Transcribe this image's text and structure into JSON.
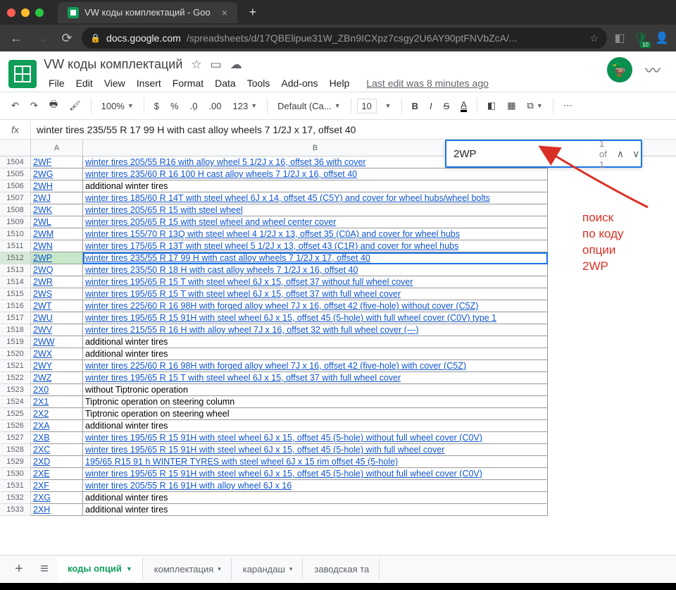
{
  "browser": {
    "tab_title": "VW коды комплектаций - Goo",
    "url_domain": "docs.google.com",
    "url_path": "/spreadsheets/d/17QBElipue31W_ZBn9ICXpz7csgy2U6AY90ptFNVbZcA/...",
    "ext_badge": "10"
  },
  "doc": {
    "title": "VW коды комплектаций",
    "last_edit": "Last edit was 8 minutes ago"
  },
  "menu": [
    "File",
    "Edit",
    "View",
    "Insert",
    "Format",
    "Data",
    "Tools",
    "Add-ons",
    "Help"
  ],
  "toolbar": {
    "zoom": "100%",
    "font": "Default (Ca...",
    "size": "10",
    "number": "123"
  },
  "formula": "winter tires 235/55 R 17 99 H with cast alloy wheels 7 1/2J x 17, offset 40",
  "columns": [
    "A",
    "B"
  ],
  "selected_row_index": 8,
  "rows": [
    {
      "n": "1504",
      "a": "2WF",
      "b": "winter tires 205/55 R16 with alloy wheel 5 1/2J x 16, offset 36 with cover"
    },
    {
      "n": "1505",
      "a": "2WG",
      "b": "winter tires 235/60 R 16 100 H cast alloy wheels 7 1/2J x 16, offset 40"
    },
    {
      "n": "1506",
      "a": "2WH",
      "b": "additional winter tires",
      "plain": true
    },
    {
      "n": "1507",
      "a": "2WJ",
      "b": "winter tires 185/60 R 14T with steel wheel 6J x 14, offset 45 (C5Y) and cover for wheel hubs/wheel bolts"
    },
    {
      "n": "1508",
      "a": "2WK",
      "b": "winter tires 205/65 R 15 with steel wheel"
    },
    {
      "n": "1509",
      "a": "2WL",
      "b": "winter tires 205/65 R 15 with steel wheel and wheel center cover"
    },
    {
      "n": "1510",
      "a": "2WM",
      "b": "winter tires 155/70 R 13Q with steel wheel 4 1/2J x 13, offset 35 (C0A) and cover for wheel hubs"
    },
    {
      "n": "1511",
      "a": "2WN",
      "b": "winter tires 175/65 R 13T with steel wheel 5 1/2J x 13, offset 43 (C1R) and cover for wheel hubs"
    },
    {
      "n": "1512",
      "a": "2WP",
      "b": "winter tires 235/55 R 17 99 H with cast alloy wheels 7 1/2J x 17, offset 40"
    },
    {
      "n": "1513",
      "a": "2WQ",
      "b": "winter tires 235/50 R 18 H with cast alloy wheels 7 1/2J x 16, offset 40"
    },
    {
      "n": "1514",
      "a": "2WR",
      "b": "winter tires 195/65 R 15 T with steel wheel 6J x 15, offset 37 without full wheel cover"
    },
    {
      "n": "1515",
      "a": "2WS",
      "b": "winter tires 195/65 R 15 T with steel wheel 6J x 15, offset 37 with full wheel cover"
    },
    {
      "n": "1516",
      "a": "2WT",
      "b": "winter tires 225/60 R 16 98H with forged alloy wheel 7J x 16, offset 42 (five-hole) without cover (C5Z)"
    },
    {
      "n": "1517",
      "a": "2WU",
      "b": "winter tires 195/65 R 15 91H with steel wheel 6J x 15, offset 45 (5-hole) with full wheel cover (C0V) type 1"
    },
    {
      "n": "1518",
      "a": "2WV",
      "b": "winter tires 215/55 R 16 H with alloy wheel 7J x 16, offset 32 with full wheel cover (---)"
    },
    {
      "n": "1519",
      "a": "2WW",
      "b": "additional winter tires",
      "plain": true
    },
    {
      "n": "1520",
      "a": "2WX",
      "b": "additional winter tires",
      "plain": true
    },
    {
      "n": "1521",
      "a": "2WY",
      "b": "winter tires 225/60 R 16 98H with forged alloy wheel 7J x 16, offset 42 (five-hole) with cover (C5Z)"
    },
    {
      "n": "1522",
      "a": "2WZ",
      "b": "winter tires 195/65 R 15 T with steel wheel 6J x 15, offset 37 with full wheel cover"
    },
    {
      "n": "1523",
      "a": "2X0",
      "b": "without Tiptronic operation",
      "plain": true
    },
    {
      "n": "1524",
      "a": "2X1",
      "b": "Tiptronic operation on steering column",
      "plain": true
    },
    {
      "n": "1525",
      "a": "2X2",
      "b": "Tiptronic operation on steering wheel",
      "plain": true
    },
    {
      "n": "1526",
      "a": "2XA",
      "b": "additional winter tires",
      "plain": true
    },
    {
      "n": "1527",
      "a": "2XB",
      "b": "winter tires 195/65 R 15 91H with steel wheel 6J x 15, offset 45 (5-hole) without full wheel cover (C0V)"
    },
    {
      "n": "1528",
      "a": "2XC",
      "b": "winter tires 195/65 R 15 91H with steel wheel 6J x 15, offset 45 (5-hole) with full wheel cover"
    },
    {
      "n": "1529",
      "a": "2XD",
      "b": "195/65 R15 91 h WINTER TYRES with steel wheel 6J x 15 rim offset 45 (5-hole)"
    },
    {
      "n": "1530",
      "a": "2XE",
      "b": "winter tires 195/65 R 15 91H with steel wheel 6J x 15, offset 45 (5-hole) without full wheel cover (C0V)"
    },
    {
      "n": "1531",
      "a": "2XF",
      "b": "winter tires 205/55 R 16 91H with alloy wheel 6J x 16"
    },
    {
      "n": "1532",
      "a": "2XG",
      "b": "additional winter tires",
      "plain": true
    },
    {
      "n": "1533",
      "a": "2XH",
      "b": "additional winter tires",
      "plain": true
    }
  ],
  "find": {
    "query": "2WP",
    "count": "1 of 1"
  },
  "annotation": {
    "l1": "поиск",
    "l2": "по коду",
    "l3": "опции",
    "l4": "2WP"
  },
  "sheets_tabs": {
    "active": "коды опций",
    "others": [
      "комплектация",
      "карандаш",
      "заводская та"
    ]
  }
}
